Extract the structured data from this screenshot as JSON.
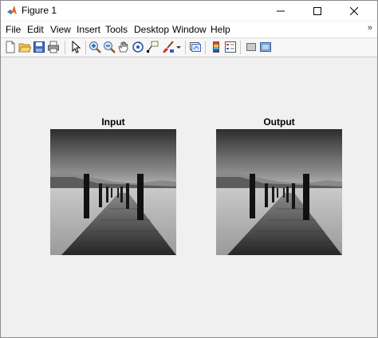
{
  "window": {
    "title": "Figure 1"
  },
  "menu": {
    "items": [
      "File",
      "Edit",
      "View",
      "Insert",
      "Tools",
      "Desktop",
      "Window",
      "Help"
    ],
    "more": "»"
  },
  "figure": {
    "left_title": "Input",
    "right_title": "Output"
  },
  "icons": {
    "toolbar": [
      "new-figure-icon",
      "open-file-icon",
      "save-icon",
      "print-icon",
      "pointer-icon",
      "zoom-in-icon",
      "zoom-out-icon",
      "pan-icon",
      "rotate-3d-icon",
      "data-cursor-icon",
      "brush-icon",
      "brush-dropdown-icon",
      "link-plot-icon",
      "colorbar-icon",
      "legend-icon",
      "hide-plot-tools-icon",
      "show-plot-tools-icon"
    ]
  }
}
